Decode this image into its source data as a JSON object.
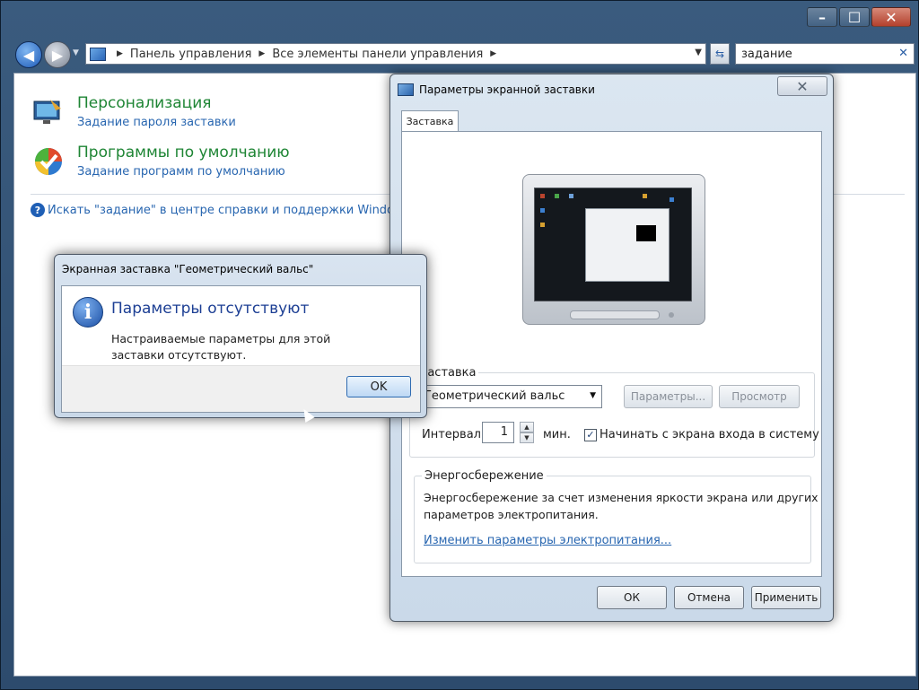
{
  "window": {
    "controls": {
      "minimize": "–",
      "maximize": "☐",
      "close": "✕"
    }
  },
  "address_bar": {
    "crumbs": [
      "Панель управления",
      "Все элементы панели управления"
    ],
    "search_value": "задание"
  },
  "results": {
    "items": [
      {
        "title": "Персонализация",
        "subtitle": "Задание пароля заставки",
        "icon": "personalization-icon"
      },
      {
        "title": "Программы по умолчанию",
        "subtitle": "Задание программ по умолчанию",
        "icon": "default-programs-icon"
      }
    ],
    "help_link": "Искать \"задание\" в центре справки и поддержки Windows"
  },
  "screensaver_dialog": {
    "title": "Параметры экранной заставки",
    "tab": "Заставка",
    "group_screensaver": "Заставка",
    "selected_screensaver": "Геометрический вальс",
    "settings_button": "Параметры...",
    "preview_button": "Просмотр",
    "interval_label": "Интервал:",
    "interval_value": "1",
    "interval_unit": "мин.",
    "logon_checkbox_label": "Начинать с экрана входа в систему",
    "logon_checked": true,
    "power_group": "Энергосбережение",
    "power_text_1": "Энергосбережение за счет изменения яркости экрана или других",
    "power_text_2": "параметров электропитания.",
    "power_link": "Изменить параметры электропитания...",
    "ok_button": "ОК",
    "cancel_button": "Отмена",
    "apply_button": "Применить"
  },
  "message_box": {
    "title": "Экранная заставка \"Геометрический вальс\"",
    "heading": "Параметры отсутствуют",
    "text": "Настраиваемые параметры для этой заставки отсутствуют.",
    "ok_button": "OK"
  },
  "colors": {
    "accent_link": "#2866b0",
    "item_title": "#1e8534",
    "heading_blue": "#1d3f94"
  }
}
